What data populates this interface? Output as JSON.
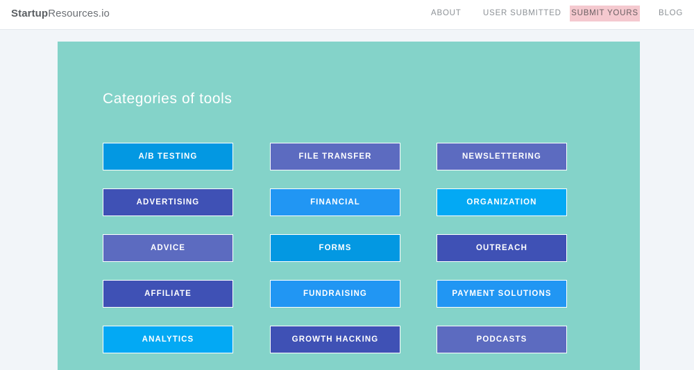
{
  "header": {
    "logo_bold": "Startup",
    "logo_rest": "Resources.io",
    "nav": {
      "about": "ABOUT",
      "user_submitted": "USER SUBMITTED",
      "submit_yours": "SUBMIT YOURS",
      "blog": "BLOG"
    }
  },
  "main": {
    "heading": "Categories of tools",
    "categories": [
      {
        "label": "A/B TESTING",
        "color": "#0398e2"
      },
      {
        "label": "FILE TRANSFER",
        "color": "#5c6bc0"
      },
      {
        "label": "NEWSLETTERING",
        "color": "#5c6bc0"
      },
      {
        "label": "ADVERTISING",
        "color": "#3f51b5"
      },
      {
        "label": "FINANCIAL",
        "color": "#2196f3"
      },
      {
        "label": "ORGANIZATION",
        "color": "#03a9f4"
      },
      {
        "label": "ADVICE",
        "color": "#5c6bc0"
      },
      {
        "label": "FORMS",
        "color": "#0398e2"
      },
      {
        "label": "OUTREACH",
        "color": "#3f51b5"
      },
      {
        "label": "AFFILIATE",
        "color": "#3f51b5"
      },
      {
        "label": "FUNDRAISING",
        "color": "#2196f3"
      },
      {
        "label": "PAYMENT SOLUTIONS",
        "color": "#2196f3"
      },
      {
        "label": "ANALYTICS",
        "color": "#03a9f4"
      },
      {
        "label": "GROWTH HACKING",
        "color": "#3f51b5"
      },
      {
        "label": "PODCASTS",
        "color": "#5c6bc0"
      }
    ]
  },
  "colors": {
    "panel": "#84d3c9",
    "submit_highlight": "#f5c9cf"
  }
}
